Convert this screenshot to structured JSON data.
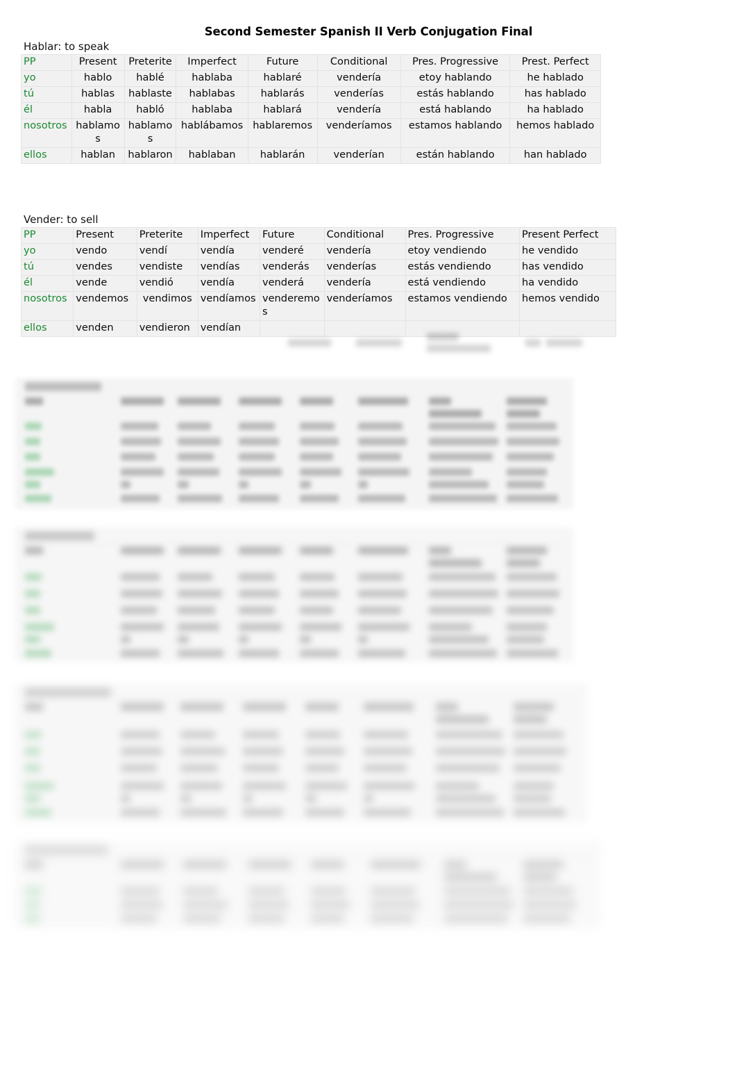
{
  "document": {
    "title": "Second Semester Spanish II Verb Conjugation Final"
  },
  "tables": [
    {
      "caption": "Hablar: to speak",
      "align": "center",
      "headers": [
        "PP",
        "Present",
        "Preterite",
        "Imperfect",
        "Future",
        "Conditional",
        "Pres. Progressive",
        "Prest. Perfect"
      ],
      "rows": [
        [
          "yo",
          "hablo",
          "hablé",
          "hablaba",
          "hablaré",
          "vendería",
          "etoy hablando",
          "he hablado"
        ],
        [
          "tú",
          "hablas",
          "hablaste",
          "hablabas",
          "hablarás",
          "venderías",
          "estás hablando",
          "has hablado"
        ],
        [
          "él",
          "habla",
          "habló",
          "hablaba",
          "hablará",
          "vendería",
          "está hablando",
          "ha hablado"
        ],
        [
          "nosotros",
          "hablamos",
          "hablamos",
          "hablábamos",
          "hablaremos",
          "venderíamos",
          "estamos hablando",
          "hemos hablado"
        ],
        [
          "ellos",
          "hablan",
          "hablaron",
          "hablaban",
          "hablarán",
          "venderían",
          "están hablando",
          "han hablado"
        ]
      ]
    },
    {
      "caption": "Vender: to sell",
      "align": "left",
      "headers": [
        "PP",
        "Present",
        "Preterite",
        "Imperfect",
        "Future",
        "Conditional",
        "Pres. Progressive",
        "Present Perfect"
      ],
      "rows": [
        [
          "yo",
          "vendo",
          "vendí",
          "vendía",
          "venderé",
          "vendería",
          "etoy vendiendo",
          "he vendido"
        ],
        [
          "tú",
          "vendes",
          "vendiste",
          "vendías",
          "venderás",
          "venderías",
          "estás vendiendo",
          "has vendido"
        ],
        [
          "él",
          "vende",
          "vendió",
          "vendía",
          "venderá",
          "vendería",
          "está vendiendo",
          "ha vendido"
        ],
        [
          "nosotros",
          "vendemos",
          "vendimos",
          "vendíamos",
          "venderemos",
          "venderíamos",
          "estamos vendiendo",
          "hemos vendido"
        ],
        [
          "ellos",
          "venden",
          "vendieron",
          "vendían",
          "",
          "",
          "",
          ""
        ]
      ]
    }
  ],
  "obscured_tables": [
    {
      "name": "verb-table-3",
      "legible": false,
      "note": "blurred"
    },
    {
      "name": "verb-table-4",
      "legible": false,
      "note": "blurred"
    },
    {
      "name": "verb-table-5",
      "legible": false,
      "note": "blurred"
    },
    {
      "name": "verb-table-6",
      "legible": false,
      "note": "blurred"
    }
  ],
  "colors": {
    "pronoun_green": "#1c8a32",
    "table_background": "#f1f1f1",
    "cell_border": "#e3e3e3",
    "text": "#0b0b0b"
  }
}
